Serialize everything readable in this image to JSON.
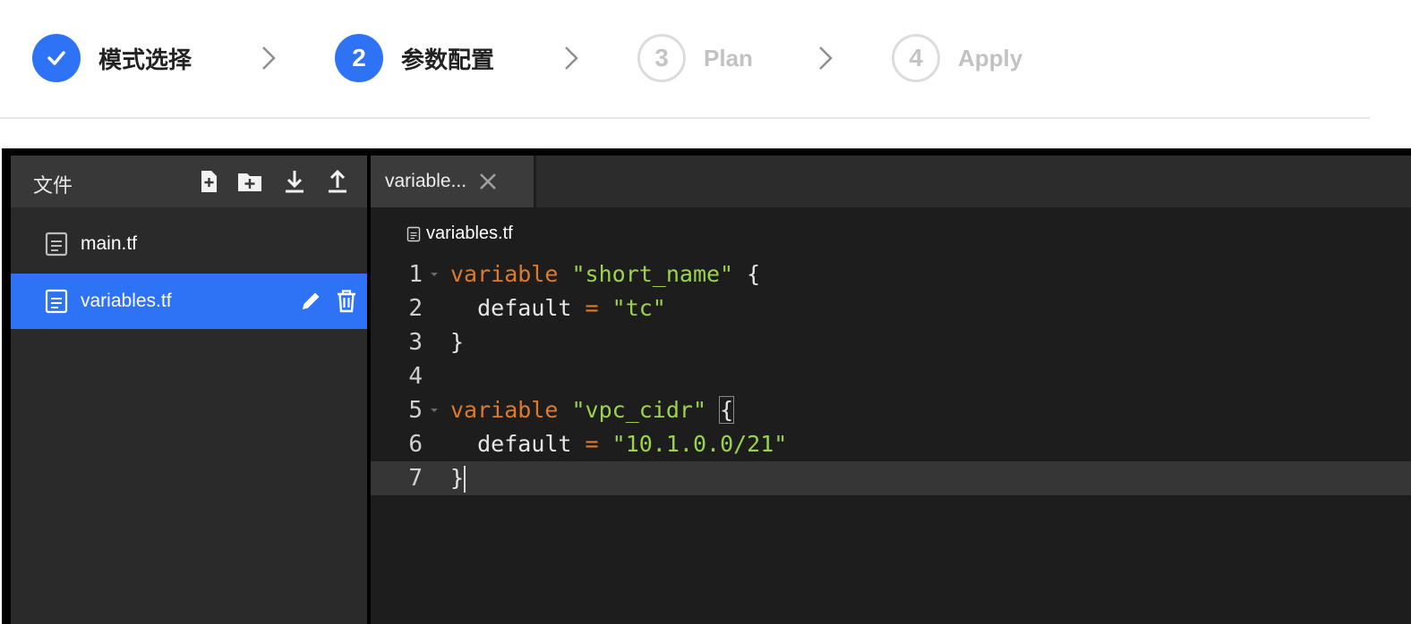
{
  "stepper": {
    "steps": [
      {
        "label": "模式选择",
        "state": "done",
        "number": ""
      },
      {
        "label": "参数配置",
        "state": "active",
        "number": "2"
      },
      {
        "label": "Plan",
        "state": "pending",
        "number": "3"
      },
      {
        "label": "Apply",
        "state": "pending",
        "number": "4"
      }
    ]
  },
  "sidebar": {
    "title": "文件",
    "tools": [
      "new-file-icon",
      "new-folder-icon",
      "download-icon",
      "upload-icon"
    ],
    "files": [
      {
        "name": "main.tf",
        "selected": false
      },
      {
        "name": "variables.tf",
        "selected": true
      }
    ]
  },
  "editor": {
    "tab_label": "variable...",
    "breadcrumb": "variables.tf",
    "lines": [
      {
        "n": "1",
        "fold": true
      },
      {
        "n": "2",
        "fold": false
      },
      {
        "n": "3",
        "fold": false
      },
      {
        "n": "4",
        "fold": false
      },
      {
        "n": "5",
        "fold": true
      },
      {
        "n": "6",
        "fold": false
      },
      {
        "n": "7",
        "fold": false,
        "current": true
      }
    ],
    "tokens": {
      "l1_kw": "variable",
      "l1_str": "\"short_name\"",
      "l1_brace": "{",
      "l2_key": "default",
      "l2_eq": "=",
      "l2_str": "\"tc\"",
      "l3_brace": "}",
      "l5_kw": "variable",
      "l5_str": "\"vpc_cidr\"",
      "l5_brace": "{",
      "l6_key": "default",
      "l6_eq": "=",
      "l6_str": "\"10.1.0.0/21\"",
      "l7_brace": "}"
    }
  },
  "colors": {
    "accent": "#2e72f5",
    "keyword": "#e07a2a",
    "string": "#9bd34a",
    "editor_bg": "#1d1d1d"
  }
}
